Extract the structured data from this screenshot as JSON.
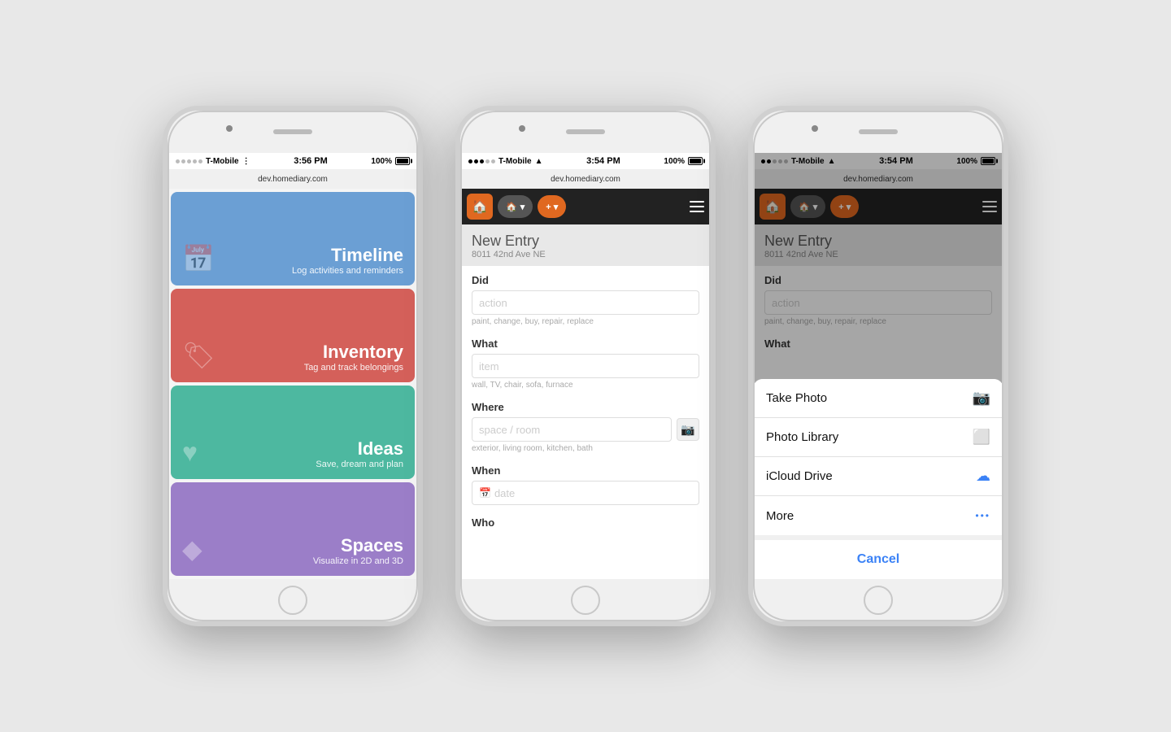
{
  "phone1": {
    "status": {
      "signal": "●●●○○",
      "carrier": "T-Mobile",
      "wifi": "wifi",
      "time": "3:56 PM",
      "battery": "100%",
      "url": "dev.homediary.com"
    },
    "tiles": [
      {
        "id": "timeline",
        "title": "Timeline",
        "subtitle": "Log activities and reminders",
        "color": "#6b9fd4",
        "icon": "📅"
      },
      {
        "id": "inventory",
        "title": "Inventory",
        "subtitle": "Tag and track belongings",
        "color": "#d4605a",
        "icon": "🏷"
      },
      {
        "id": "ideas",
        "title": "Ideas",
        "subtitle": "Save, dream and plan",
        "color": "#4db8a0",
        "icon": "♥"
      },
      {
        "id": "spaces",
        "title": "Spaces",
        "subtitle": "Visualize in 2D and 3D",
        "color": "#9b7ec8",
        "icon": "◆"
      }
    ]
  },
  "phone2": {
    "status": {
      "time": "3:54 PM",
      "battery": "100%",
      "url": "dev.homediary.com"
    },
    "header": {
      "home_label": "▾",
      "add_label": "+ ▾"
    },
    "form": {
      "title": "New Entry",
      "address": "8011 42nd Ave NE",
      "fields": {
        "did_label": "Did",
        "did_placeholder": "action",
        "did_hint": "paint, change, buy, repair, replace",
        "what_label": "What",
        "what_placeholder": "item",
        "what_hint": "wall, TV, chair, sofa, furnace",
        "where_label": "Where",
        "where_placeholder": "space / room",
        "where_hint": "exterior, living room, kitchen, bath",
        "when_label": "When",
        "when_placeholder": "date",
        "who_label": "Who"
      }
    }
  },
  "phone3": {
    "status": {
      "time": "3:54 PM",
      "battery": "100%",
      "url": "dev.homediary.com"
    },
    "form": {
      "title": "New Entry",
      "address": "8011 42nd Ave NE",
      "fields": {
        "did_label": "Did",
        "did_placeholder": "action",
        "did_hint": "paint, change, buy, repair, replace",
        "what_label": "What"
      }
    },
    "action_sheet": {
      "items": [
        {
          "id": "take-photo",
          "label": "Take Photo",
          "icon": "📷"
        },
        {
          "id": "photo-library",
          "label": "Photo Library",
          "icon": "🖼"
        },
        {
          "id": "icloud-drive",
          "label": "iCloud Drive",
          "icon": "☁"
        },
        {
          "id": "more",
          "label": "More",
          "icon": "•••"
        }
      ],
      "cancel_label": "Cancel"
    }
  }
}
